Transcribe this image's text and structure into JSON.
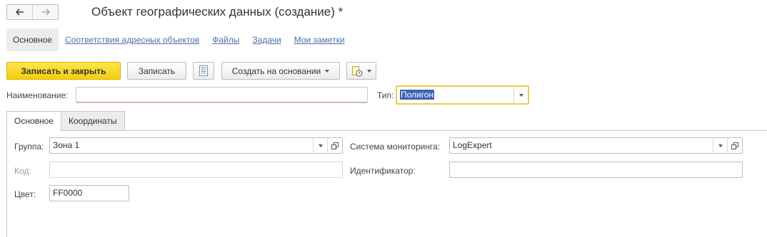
{
  "window": {
    "title": "Объект географических данных (создание) *"
  },
  "nav": {
    "back_icon": "arrow-left-icon",
    "forward_icon": "arrow-right-icon"
  },
  "section_tabs": [
    {
      "label": "Основное",
      "active": true
    },
    {
      "label": "Соответствия адресных объектов"
    },
    {
      "label": "Файлы"
    },
    {
      "label": "Задачи"
    },
    {
      "label": "Мои заметки"
    }
  ],
  "toolbar": {
    "save_close_label": "Записать и закрыть",
    "save_label": "Записать",
    "list_icon": "document-list-icon",
    "create_based_label": "Создать на основании",
    "report_icon": "report-clock-icon"
  },
  "form": {
    "name_label": "Наименование:",
    "name_value": "",
    "type_label": "Тип:",
    "type_value": "Полигон"
  },
  "tabs": [
    {
      "label": "Основное",
      "active": true
    },
    {
      "label": "Координаты"
    }
  ],
  "main": {
    "group_label": "Группа:",
    "group_value": "Зона 1",
    "monitoring_label": "Система мониторинга:",
    "monitoring_value": "LogExpert",
    "code_label": "Код:",
    "code_value": "",
    "identifier_label": "Идентификатор:",
    "identifier_value": "",
    "color_label": "Цвет:",
    "color_value": "FF0000"
  },
  "colors": {
    "primary_button": "#f4cf0e",
    "link": "#4a6fa5",
    "focus_border": "#f2c84b",
    "selection": "#3b64b3"
  }
}
